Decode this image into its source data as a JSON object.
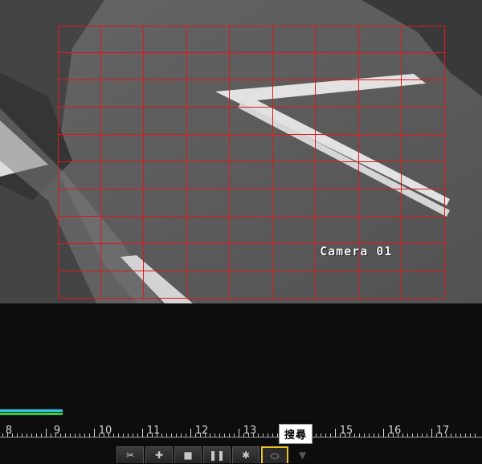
{
  "camera": {
    "osd_label": "Camera 01"
  },
  "grid": {
    "cols": 9,
    "rows": 10,
    "color": "#e0181c"
  },
  "timeline": {
    "ticks": [
      "8",
      "9",
      "10",
      "11",
      "12",
      "13",
      "14",
      "15",
      "16",
      "17"
    ],
    "record_bar_color": "#36c6e8",
    "record_bar_color_2": "#2fd23f",
    "record_bar_fill": 0.13
  },
  "toolbar": {
    "buttons": [
      {
        "icon": "cut-icon",
        "glyph": "✂"
      },
      {
        "icon": "tag-icon",
        "glyph": "✚"
      },
      {
        "icon": "stop-icon",
        "glyph": "■"
      },
      {
        "icon": "pause-icon",
        "glyph": "❚❚"
      },
      {
        "icon": "rewind-icon",
        "glyph": "✱"
      },
      {
        "icon": "search-icon",
        "glyph": "⬭"
      }
    ],
    "active_index": 5,
    "tooltip": "搜尋",
    "highlight_color": "#e8c42a"
  }
}
